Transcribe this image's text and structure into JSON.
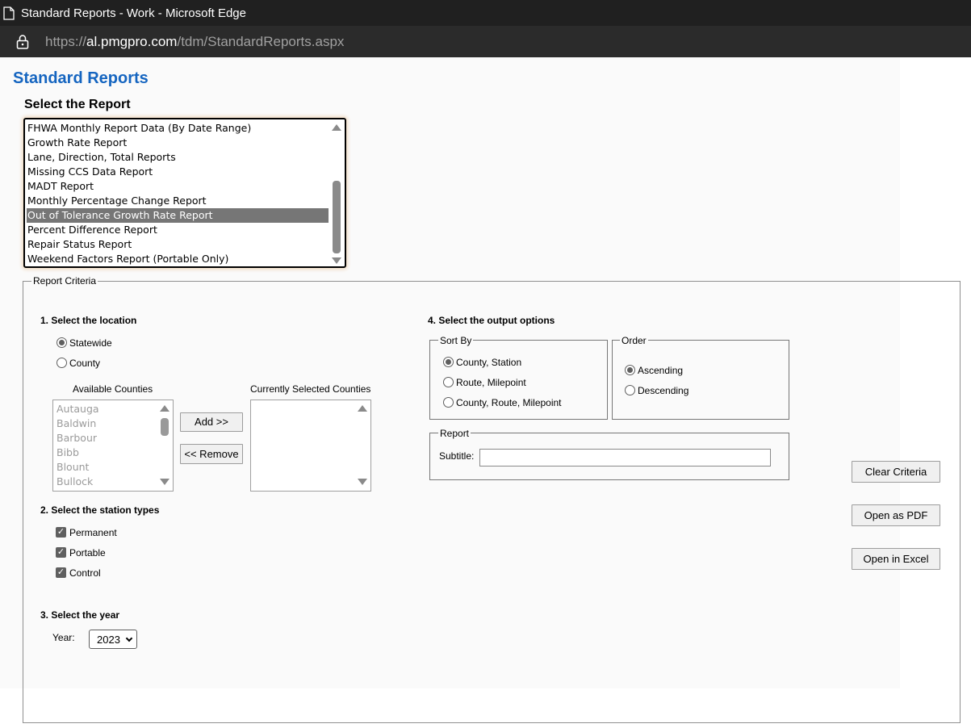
{
  "browser": {
    "window_title": "Standard Reports - Work - Microsoft Edge",
    "url_prefix": "https://",
    "url_host": "al.pmgpro.com",
    "url_path": "/tdm/StandardReports.aspx"
  },
  "page": {
    "title": "Standard Reports",
    "select_report_label": "Select the Report",
    "report_options": [
      "FHWA Monthly Report Data (By Date Range)",
      "Growth Rate Report",
      "Lane, Direction, Total Reports",
      "Missing CCS Data Report",
      "MADT Report",
      "Monthly Percentage Change Report",
      "Out of Tolerance Growth Rate Report",
      "Percent Difference Report",
      "Repair Status Report",
      "Weekend Factors Report (Portable Only)"
    ],
    "selected_report": "Out of Tolerance Growth Rate Report"
  },
  "criteria": {
    "legend": "Report Criteria",
    "location": {
      "label": "1. Select the location",
      "statewide": "Statewide",
      "county": "County",
      "selected": "Statewide",
      "available_label": "Available Counties",
      "selected_label": "Currently Selected Counties",
      "available_counties": [
        "Autauga",
        "Baldwin",
        "Barbour",
        "Bibb",
        "Blount",
        "Bullock"
      ],
      "add_button": "Add >>",
      "remove_button": "<< Remove"
    },
    "station_types": {
      "label": "2. Select the station types",
      "permanent": "Permanent",
      "portable": "Portable",
      "control": "Control"
    },
    "year": {
      "label": "3. Select the year",
      "field_label": "Year:",
      "value": "2023"
    },
    "output": {
      "label": "4. Select the output options",
      "sort_by_legend": "Sort By",
      "sort_options": [
        "County, Station",
        "Route, Milepoint",
        "County, Route, Milepoint"
      ],
      "sort_selected": "County, Station",
      "order_legend": "Order",
      "ascending": "Ascending",
      "descending": "Descending",
      "order_selected": "Ascending",
      "report_legend": "Report",
      "subtitle_label": "Subtitle:",
      "subtitle_value": ""
    },
    "buttons": {
      "clear": "Clear Criteria",
      "pdf": "Open as PDF",
      "excel": "Open in Excel"
    }
  },
  "colors": {
    "title_blue": "#1565c0",
    "selected_row": "#767676",
    "chrome_dark": "#202020"
  }
}
